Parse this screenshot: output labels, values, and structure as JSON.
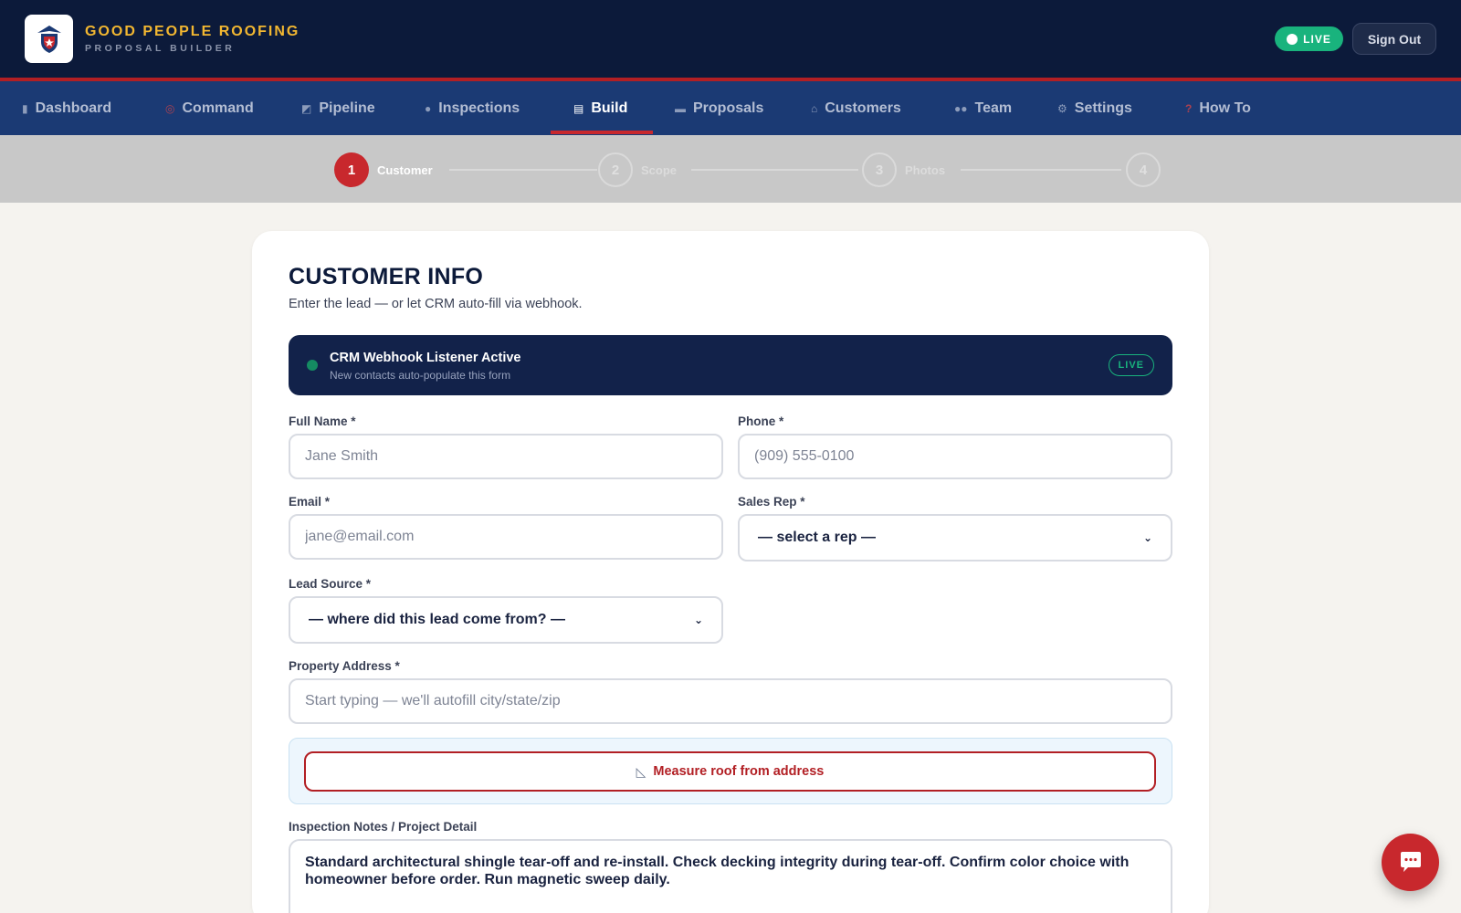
{
  "brand": {
    "title": "GOOD PEOPLE ROOFING",
    "subtitle": "PROPOSAL BUILDER"
  },
  "header": {
    "live_label": "LIVE",
    "signout_label": "Sign Out"
  },
  "nav": {
    "items": [
      {
        "label": "Dashboard",
        "icon": "chart-icon"
      },
      {
        "label": "Command",
        "icon": "target-icon"
      },
      {
        "label": "Pipeline",
        "icon": "trend-icon"
      },
      {
        "label": "Inspections",
        "icon": "magnifier-icon"
      },
      {
        "label": "Build",
        "icon": "clipboard-icon",
        "active": true
      },
      {
        "label": "Proposals",
        "icon": "document-icon"
      },
      {
        "label": "Customers",
        "icon": "house-icon"
      },
      {
        "label": "Team",
        "icon": "people-icon"
      },
      {
        "label": "Settings",
        "icon": "gear-icon"
      },
      {
        "label": "How To",
        "icon": "question-icon"
      }
    ]
  },
  "stepper": {
    "steps": [
      {
        "number": "1",
        "label": "Customer",
        "state": "active"
      },
      {
        "number": "2",
        "label": "Scope",
        "state": "todo"
      },
      {
        "number": "3",
        "label": "Photos",
        "state": "todo"
      },
      {
        "number": "4",
        "label": "",
        "state": "todo"
      }
    ]
  },
  "form": {
    "title": "CUSTOMER INFO",
    "subtitle": "Enter the lead — or let CRM auto-fill via webhook.",
    "webhook": {
      "title": "CRM Webhook Listener Active",
      "subtitle": "New contacts auto-populate this form",
      "badge": "LIVE"
    },
    "full_name": {
      "label": "Full Name *",
      "placeholder": "Jane Smith",
      "value": ""
    },
    "phone": {
      "label": "Phone *",
      "placeholder": "(909) 555-0100",
      "value": ""
    },
    "email": {
      "label": "Email *",
      "placeholder": "jane@email.com",
      "value": ""
    },
    "sales_rep": {
      "label": "Sales Rep *",
      "selected": "— select a rep —"
    },
    "lead_source": {
      "label": "Lead Source *",
      "selected": "— where did this lead come from? —"
    },
    "address": {
      "label": "Property Address *",
      "placeholder": "Start typing — we'll autofill city/state/zip",
      "value": ""
    },
    "measure_button": "Measure roof from address",
    "notes": {
      "label": "Inspection Notes / Project Detail",
      "value": "Standard architectural shingle tear-off and re-install. Check decking integrity during tear-off. Confirm color choice with homeowner before order. Run magnetic sweep daily."
    }
  },
  "colors": {
    "navy": "#0c1a3a",
    "nav_blue": "#1b3a74",
    "brand_gold": "#f2b731",
    "accent_red": "#c8282d",
    "live_green": "#19b37d"
  }
}
